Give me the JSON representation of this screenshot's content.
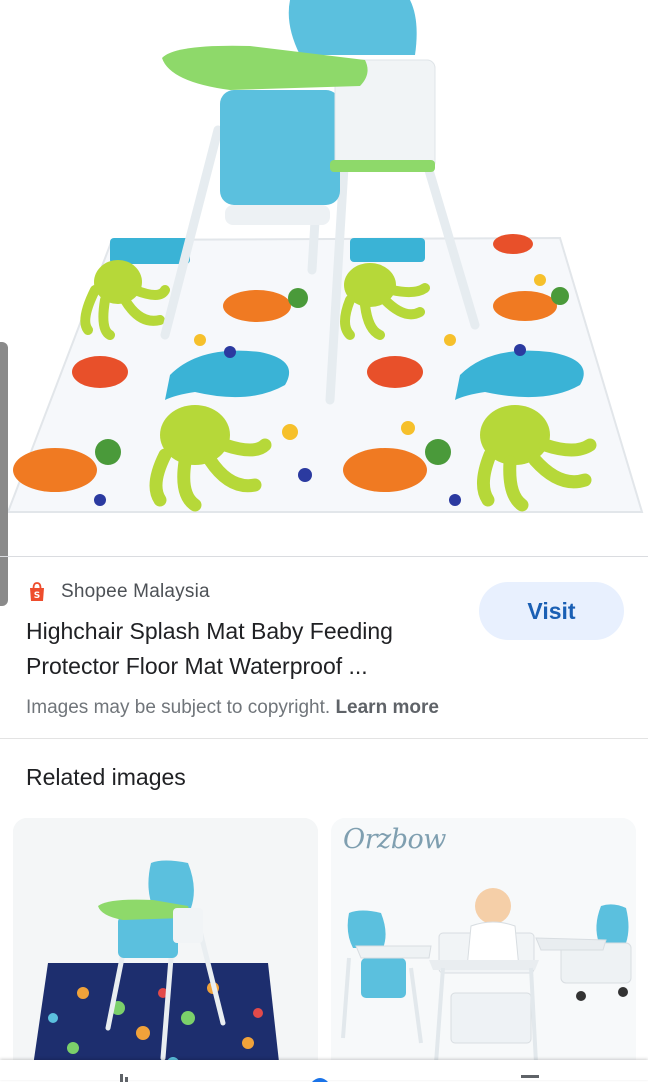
{
  "result": {
    "source": {
      "icon": "shopee-bag-icon",
      "name": "Shopee Malaysia",
      "brand_color": "#ee4d2d"
    },
    "visit_label": "Visit",
    "title_lines": [
      "Highchair Splash Mat Baby Feeding",
      "Protector Floor Mat Waterproof ..."
    ],
    "copyright_text": "Images may be subject to copyright.",
    "learn_more_label": "Learn more"
  },
  "related": {
    "heading": "Related images",
    "cards": [
      {
        "brand": ""
      },
      {
        "brand": "Orzbow"
      }
    ]
  },
  "nav": {
    "icons": [
      "home-icon",
      "search-icon",
      "tabs-icon"
    ]
  },
  "colors": {
    "accent": "#1a5fb4",
    "visit_bg": "#e8f0fe",
    "mat_chair": "#5bc0de",
    "tray": "#8ed96a"
  }
}
